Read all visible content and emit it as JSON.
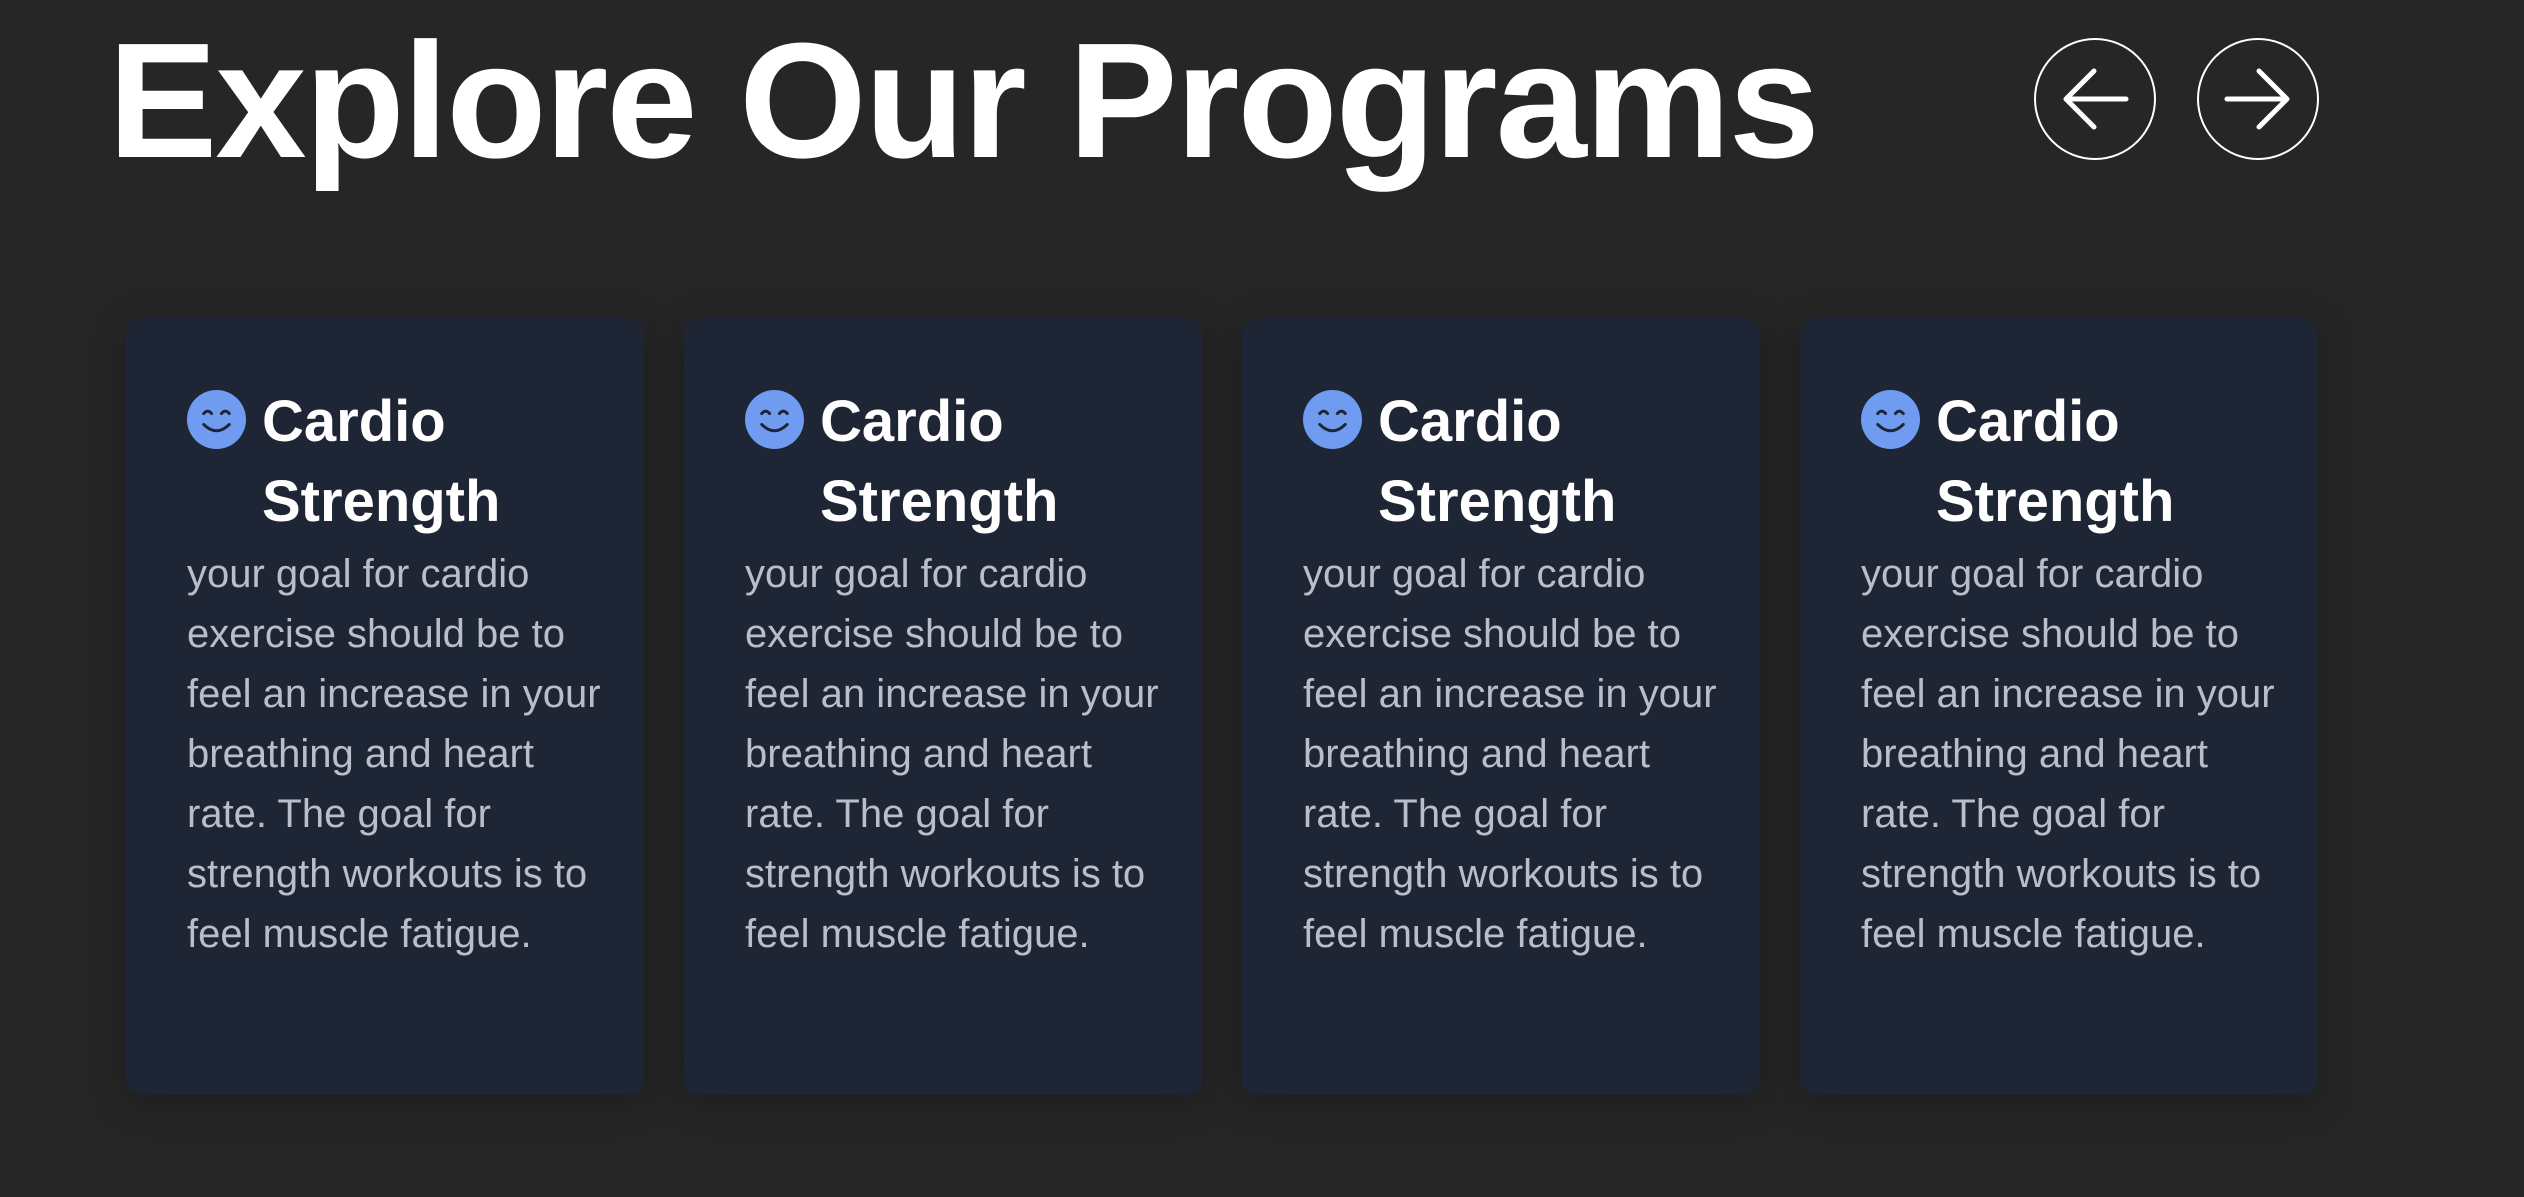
{
  "header": {
    "title": "Explore Our Programs",
    "prev_icon": "arrow-left-icon",
    "next_icon": "arrow-right-icon"
  },
  "theme": {
    "background": "#262626",
    "card_background": "#1e2636",
    "title_color": "#ffffff",
    "text_color": "#b9bec8",
    "icon_color": "#6f9bf0"
  },
  "programs": [
    {
      "icon": "smiley-icon",
      "title": "Cardio Strength",
      "description": "your goal for cardio exercise should be to feel an increase in your breathing and heart rate. The goal for strength workouts is to feel muscle fatigue."
    },
    {
      "icon": "smiley-icon",
      "title": "Cardio Strength",
      "description": "your goal for cardio exercise should be to feel an increase in your breathing and heart rate. The goal for strength workouts is to feel muscle fatigue."
    },
    {
      "icon": "smiley-icon",
      "title": "Cardio Strength",
      "description": "your goal for cardio exercise should be to feel an increase in your breathing and heart rate. The goal for strength workouts is to feel muscle fatigue."
    },
    {
      "icon": "smiley-icon",
      "title": "Cardio Strength",
      "description": "your goal for cardio exercise should be to feel an increase in your breathing and heart rate. The goal for strength workouts is to feel muscle fatigue."
    }
  ]
}
